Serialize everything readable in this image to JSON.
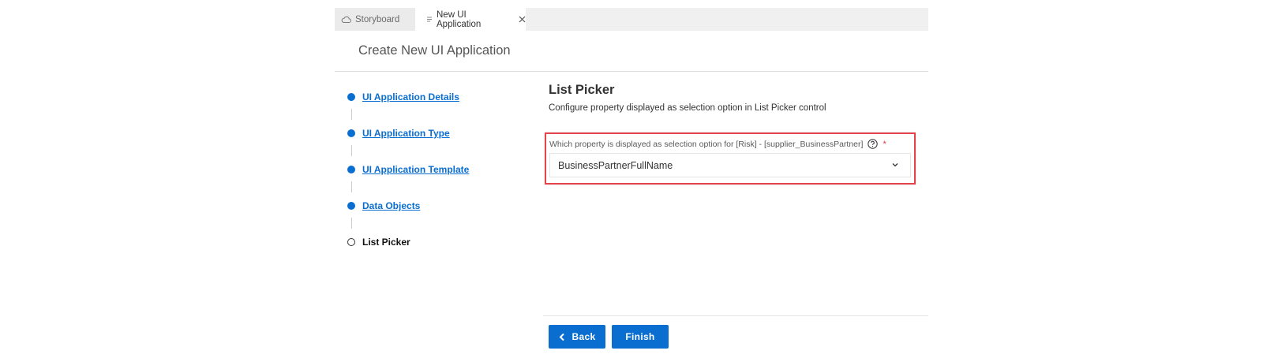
{
  "tabs": [
    {
      "label": "Storyboard",
      "icon": "cloud-icon",
      "active": false
    },
    {
      "label": "New UI Application",
      "icon": "document-icon",
      "active": true
    }
  ],
  "page": {
    "title": "Create New UI Application"
  },
  "steps": [
    {
      "label": "UI Application Details",
      "status": "completed"
    },
    {
      "label": "UI Application Type",
      "status": "completed"
    },
    {
      "label": "UI Application Template",
      "status": "completed"
    },
    {
      "label": "Data Objects",
      "status": "completed"
    },
    {
      "label": "List Picker",
      "status": "current"
    }
  ],
  "content": {
    "title": "List Picker",
    "description": "Configure property displayed as selection option in List Picker control",
    "field": {
      "label": "Which property is displayed as selection option for [Risk] - [supplier_BusinessPartner]",
      "required_mark": "*",
      "value": "BusinessPartnerFullName"
    }
  },
  "buttons": {
    "back": "Back",
    "finish": "Finish"
  },
  "colors": {
    "accent": "#0a6ed1",
    "highlight_border": "#e5434b"
  }
}
